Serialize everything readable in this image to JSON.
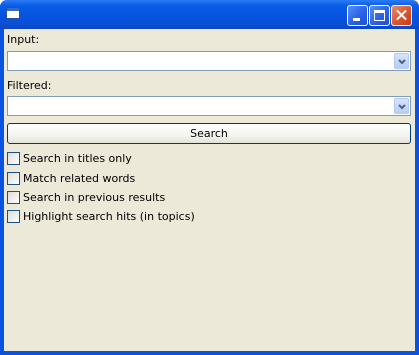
{
  "window": {
    "title": ""
  },
  "form": {
    "input_label": "Input:",
    "input_value": "",
    "filtered_label": "Filtered:",
    "filtered_value": "",
    "search_button": "Search"
  },
  "options": [
    {
      "label": "Search in titles only",
      "checked": false
    },
    {
      "label": "Match related words",
      "checked": false
    },
    {
      "label": "Search in previous results",
      "checked": false
    },
    {
      "label": "Highlight search hits (in topics)",
      "checked": false
    }
  ],
  "colors": {
    "titlebar": "#0553df",
    "client_background": "#ece9d8",
    "field_border": "#7f9db9",
    "button_border": "#003c74",
    "close_button": "#d9542f"
  },
  "icons": {
    "app": "window-icon",
    "minimize": "minimize-icon",
    "maximize": "maximize-icon",
    "close": "close-icon",
    "dropdown": "chevron-down-icon"
  }
}
